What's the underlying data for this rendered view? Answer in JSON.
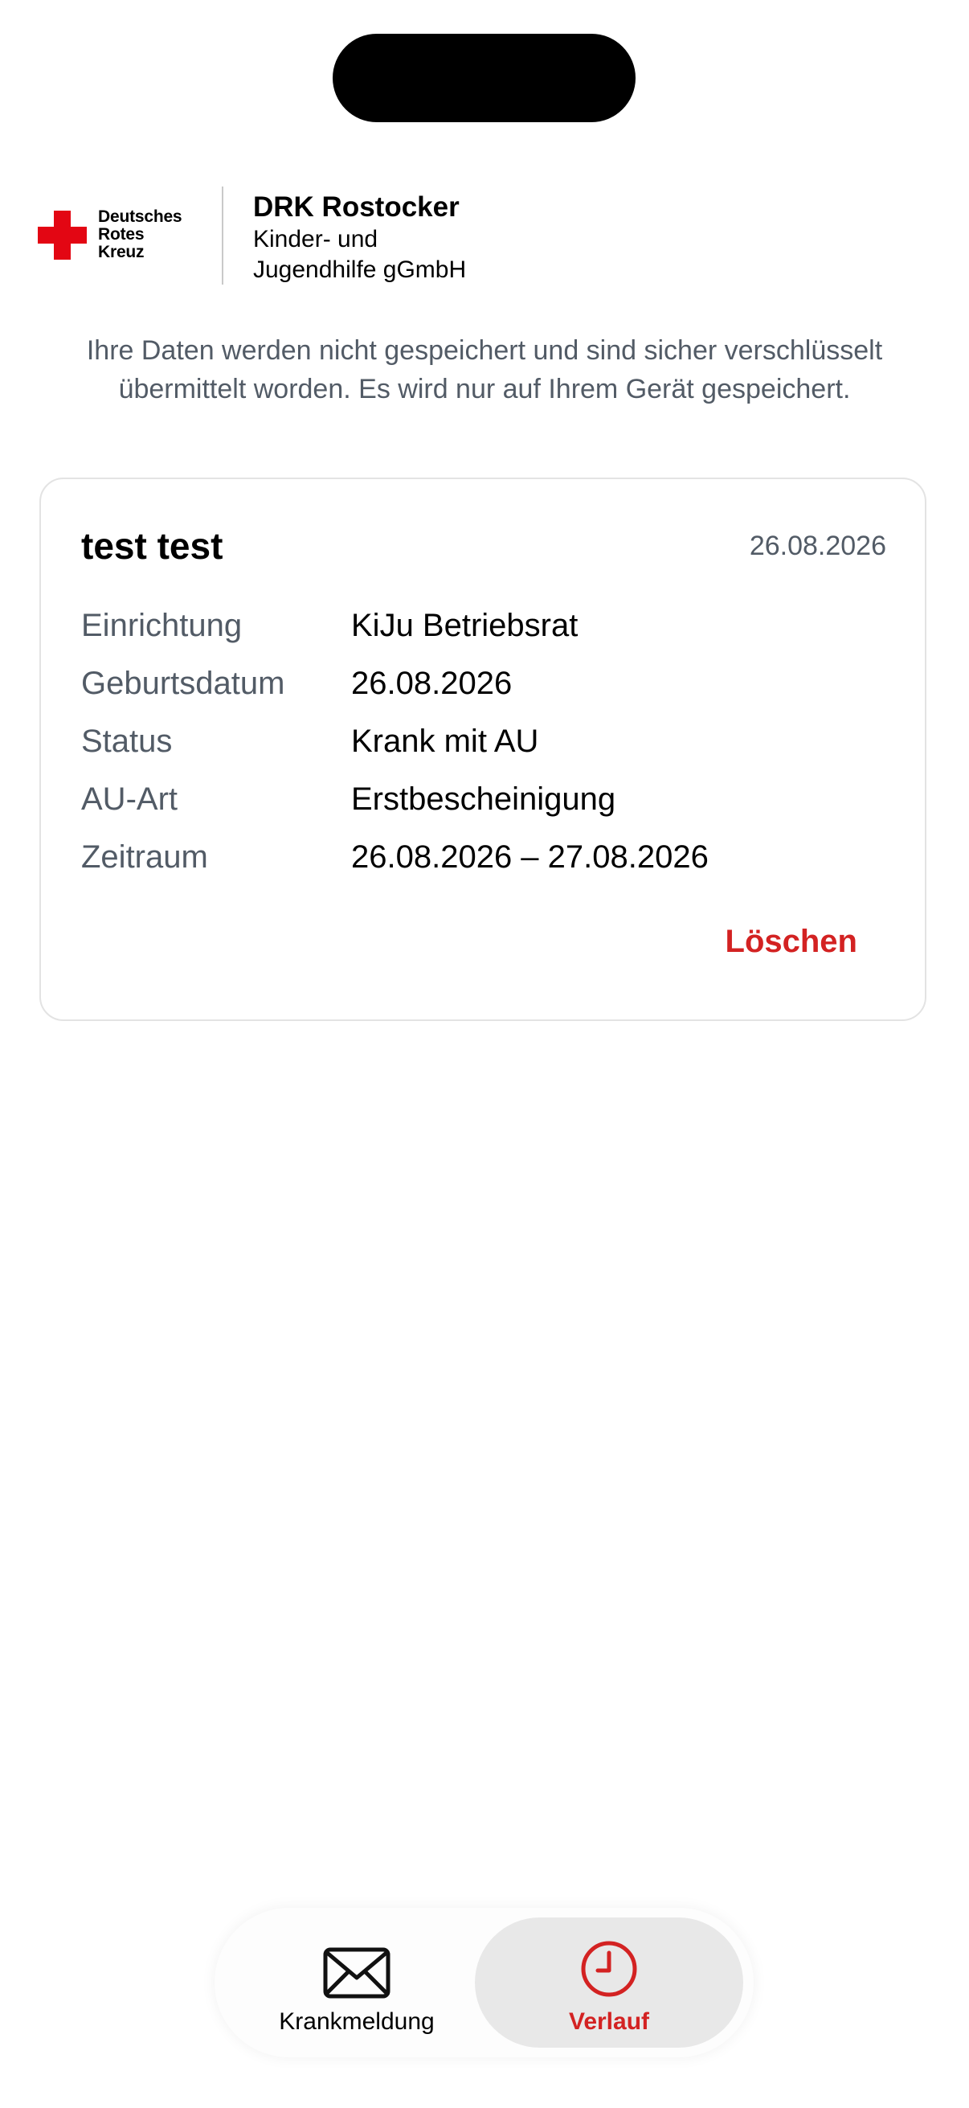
{
  "header": {
    "logo_lines": [
      "Deutsches",
      "Rotes",
      "Kreuz"
    ],
    "org_title": "DRK Rostocker",
    "org_sub_line1": "Kinder- und",
    "org_sub_line2": "Jugendhilfe gGmbH"
  },
  "notice": "Ihre Daten werden nicht gespeichert und sind sicher verschlüsselt übermittelt worden. Es wird nur auf Ihrem Gerät gespeichert.",
  "card": {
    "name": "test test",
    "date": "26.08.2026",
    "rows": [
      {
        "label": "Einrichtung",
        "value": "KiJu Betriebsrat"
      },
      {
        "label": "Geburtsdatum",
        "value": "26.08.2026"
      },
      {
        "label": "Status",
        "value": "Krank mit AU"
      },
      {
        "label": "AU-Art",
        "value": "Erstbescheinigung"
      },
      {
        "label": "Zeitraum",
        "value": "26.08.2026 – 27.08.2026"
      }
    ],
    "delete_label": "Löschen"
  },
  "tabs": [
    {
      "label": "Krankmeldung",
      "icon": "envelope-icon",
      "active": false
    },
    {
      "label": "Verlauf",
      "icon": "clock-icon",
      "active": true
    }
  ],
  "colors": {
    "accent": "#d32222",
    "logo_red": "#e30613",
    "muted_text": "#525b66"
  }
}
